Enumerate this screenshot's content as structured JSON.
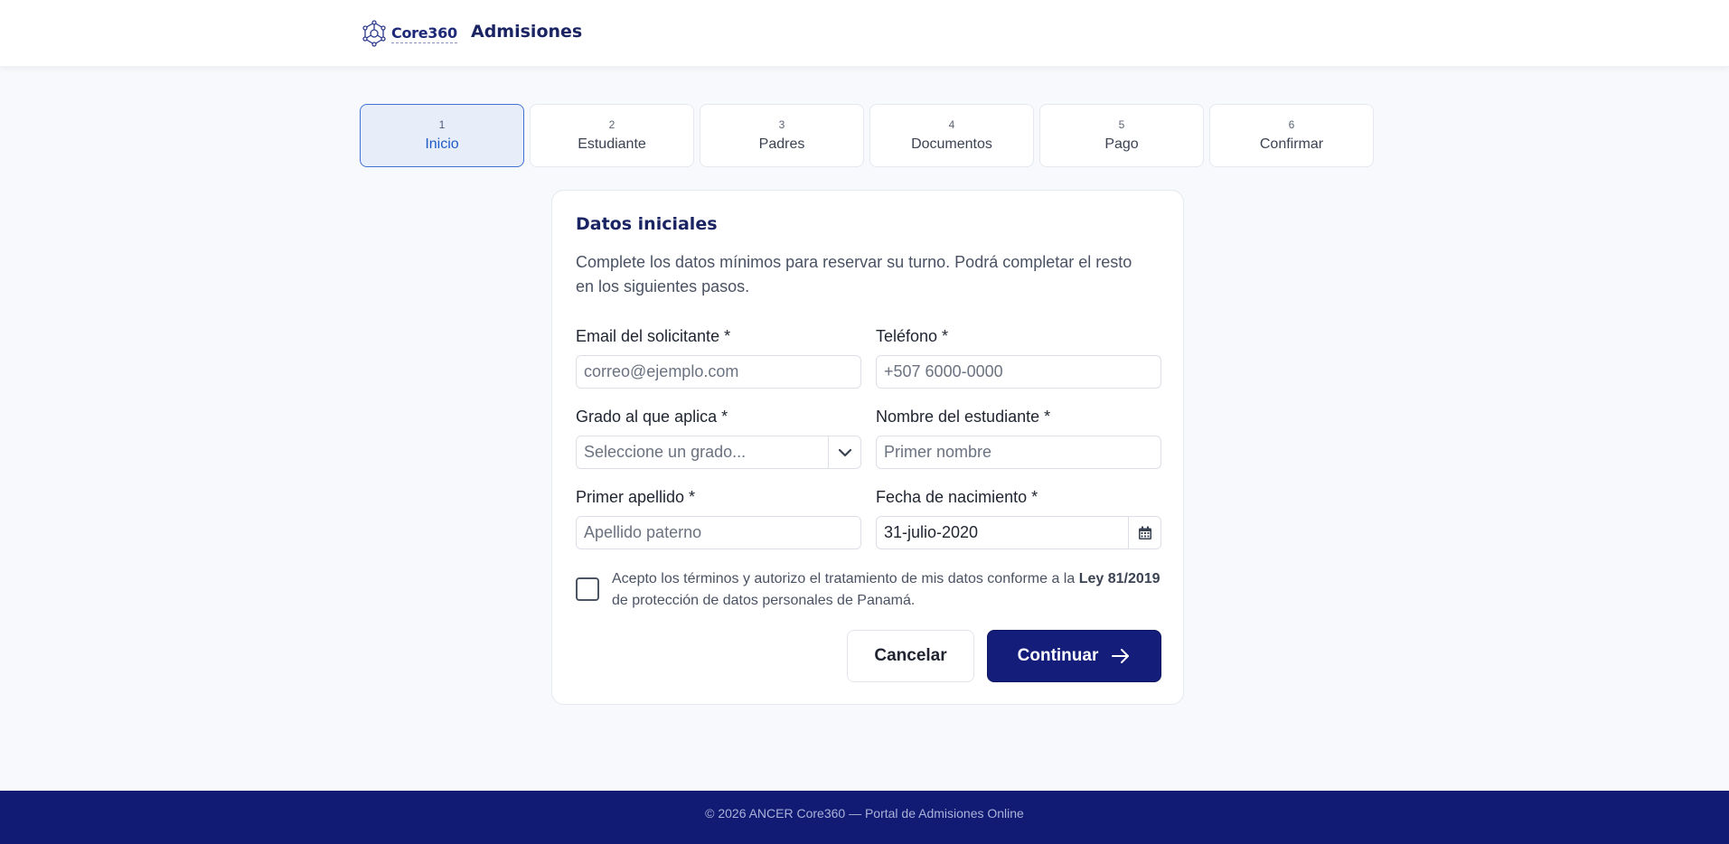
{
  "header": {
    "logo_text": "Core360",
    "app_title": "Admisiones"
  },
  "stepper": {
    "steps": [
      {
        "num": "1",
        "label": "Inicio",
        "active": true
      },
      {
        "num": "2",
        "label": "Estudiante"
      },
      {
        "num": "3",
        "label": "Padres"
      },
      {
        "num": "4",
        "label": "Documentos"
      },
      {
        "num": "5",
        "label": "Pago"
      },
      {
        "num": "6",
        "label": "Confirmar"
      }
    ]
  },
  "form": {
    "title": "Datos iniciales",
    "description": "Complete los datos mínimos para reservar su turno. Podrá completar el resto en los siguientes pasos.",
    "email": {
      "label": "Email del solicitante *",
      "placeholder": "correo@ejemplo.com",
      "value": ""
    },
    "phone": {
      "label": "Teléfono *",
      "placeholder": "+507 6000-0000",
      "value": ""
    },
    "grade": {
      "label": "Grado al que aplica *",
      "selected": "Seleccione un grado..."
    },
    "student_name": {
      "label": "Nombre del estudiante *",
      "placeholder": "Primer nombre",
      "value": ""
    },
    "last_name": {
      "label": "Primer apellido *",
      "placeholder": "Apellido paterno",
      "value": ""
    },
    "birth_date": {
      "label": "Fecha de nacimiento *",
      "value": "31-julio-2020"
    },
    "consent": {
      "text_before": "Acepto los términos y autorizo el tratamiento de mis datos conforme a la",
      "law": "Ley 81/2019",
      "text_after": "de protección de datos personales de Panamá."
    },
    "cancel_label": "Cancelar",
    "continue_label": "Continuar"
  },
  "footer": {
    "text": "© 2026 ANCER Core360 — Portal de Admisiones Online"
  },
  "colors": {
    "primary": "#141e7a",
    "active_step_bg": "#e8eef9",
    "active_step_border": "#3f72d4",
    "footer_bg": "#121b73"
  }
}
